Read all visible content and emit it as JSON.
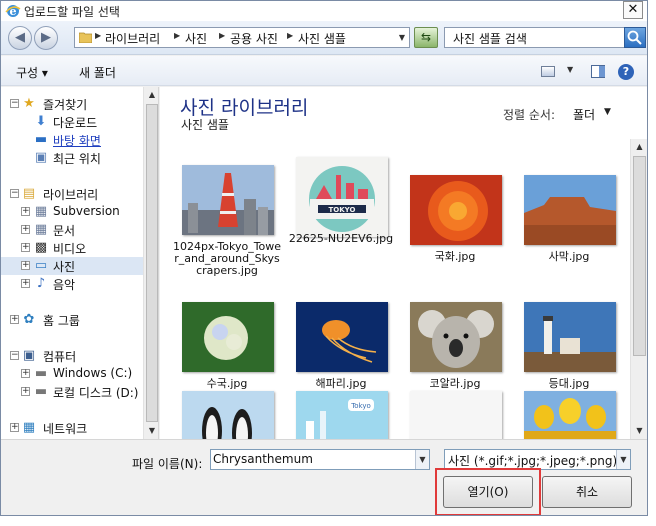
{
  "window": {
    "title": "업로드할 파일 선택",
    "close_label": "✕"
  },
  "address": {
    "crumbs": [
      "라이브러리",
      "사진",
      "공용 사진",
      "사진 샘플"
    ]
  },
  "search": {
    "placeholder": "사진 샘플 검색"
  },
  "toolbar": {
    "organize_label": "구성 ▾",
    "new_folder_label": "새 폴더"
  },
  "nav": {
    "favorites": {
      "label": "즐겨찾기",
      "items": [
        "다운로드",
        "바탕 화면",
        "최근 위치"
      ]
    },
    "libraries": {
      "label": "라이브러리",
      "items": [
        "Subversion",
        "문서",
        "비디오",
        "사진",
        "음악"
      ]
    },
    "homegroup": "홈 그룹",
    "computer": {
      "label": "컴퓨터",
      "items": [
        "Windows (C:)",
        "로컬 디스크 (D:)"
      ]
    },
    "network": "네트워크"
  },
  "content": {
    "title": "사진 라이브러리",
    "subtitle": "사진 샘플",
    "arrange_label": "정렬 순서:",
    "arrange_value": "폴더",
    "files": [
      "1024px-Tokyo_Tower_and_around_Skyscrapers.jpg",
      "22625-NU2EV6.jpg",
      "국화.jpg",
      "사막.jpg",
      "수국.jpg",
      "해파리.jpg",
      "코알라.jpg",
      "등대.jpg",
      "",
      "",
      "",
      ""
    ]
  },
  "footer": {
    "filename_label": "파일 이름(N):",
    "filename_value": "Chrysanthemum",
    "filetype_value": "사진 (*.gif;*.jpg;*.jpeg;*.png)",
    "open_label": "열기(O)",
    "cancel_label": "취소"
  },
  "colors": {
    "title_blue": "#1e3287",
    "selection": "#dbe6f4",
    "highlight_red": "#e03a3a"
  }
}
